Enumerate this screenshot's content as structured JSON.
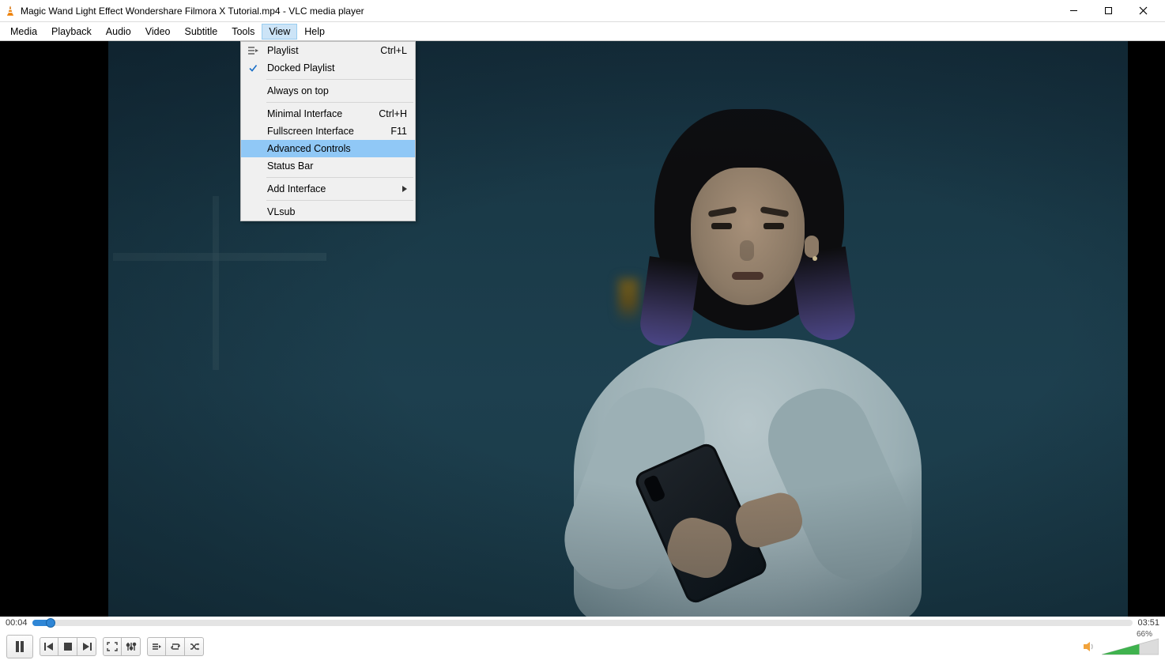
{
  "window": {
    "title": "Magic Wand Light Effect  Wondershare Filmora X Tutorial.mp4 - VLC media player"
  },
  "menubar": {
    "items": [
      "Media",
      "Playback",
      "Audio",
      "Video",
      "Subtitle",
      "Tools",
      "View",
      "Help"
    ],
    "open_index": 6
  },
  "view_menu": {
    "playlist": {
      "label": "Playlist",
      "shortcut": "Ctrl+L"
    },
    "docked_playlist": {
      "label": "Docked Playlist",
      "checked": true
    },
    "always_on_top": {
      "label": "Always on top"
    },
    "minimal_interface": {
      "label": "Minimal Interface",
      "shortcut": "Ctrl+H"
    },
    "fullscreen_interface": {
      "label": "Fullscreen Interface",
      "shortcut": "F11"
    },
    "advanced_controls": {
      "label": "Advanced Controls",
      "highlighted": true
    },
    "status_bar": {
      "label": "Status Bar"
    },
    "add_interface": {
      "label": "Add Interface",
      "submenu": true
    },
    "vlsub": {
      "label": "VLsub"
    }
  },
  "seek": {
    "current": "00:04",
    "total": "03:51",
    "progress_percent": 1.7
  },
  "volume": {
    "percent_label": "66%",
    "percent": 66
  },
  "controls": {
    "play_pause": "pause",
    "previous": "previous",
    "stop": "stop",
    "next": "next",
    "fullscreen": "fullscreen",
    "ext_settings": "extended-settings",
    "playlist": "playlist",
    "loop": "loop",
    "random": "random"
  }
}
